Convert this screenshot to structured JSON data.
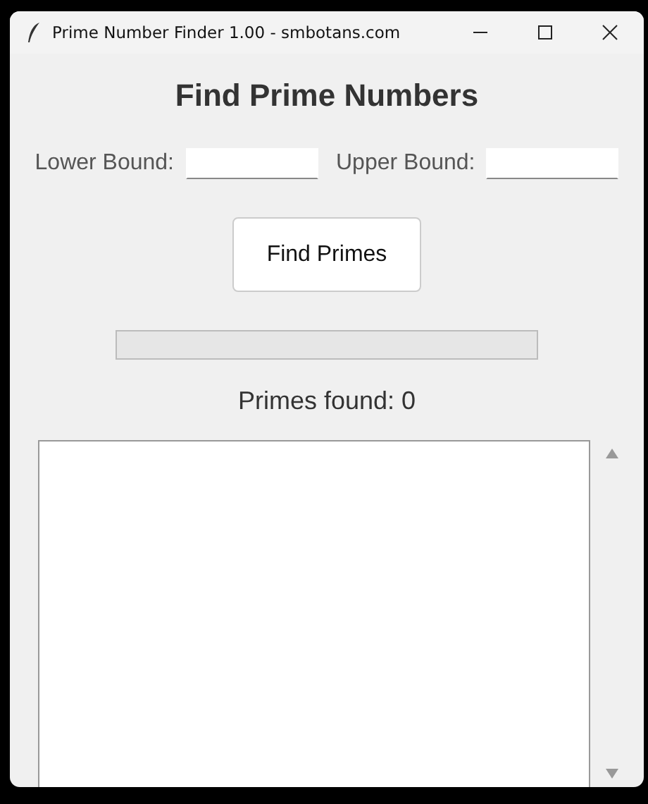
{
  "window": {
    "title": "Prime Number Finder 1.00 - smbotans.com"
  },
  "heading": "Find Prime Numbers",
  "fields": [
    {
      "label": "Lower Bound:"
    },
    {
      "label": "Upper Bound:"
    }
  ],
  "button": "Find Primes",
  "progress": {
    "level": 0
  },
  "result_label": "Primes found: 0"
}
